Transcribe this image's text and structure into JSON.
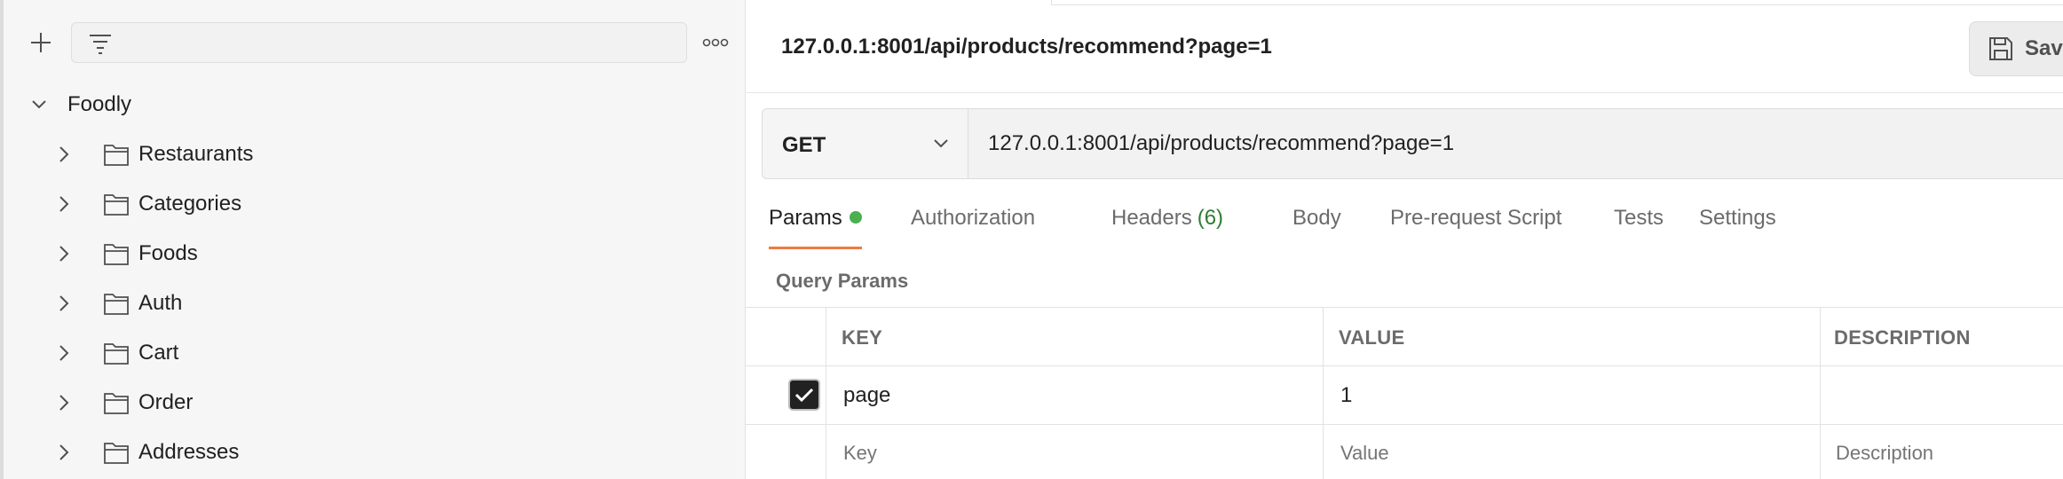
{
  "sidebar": {
    "filter_placeholder": "",
    "collection": {
      "name": "Foodly",
      "folders": [
        {
          "label": "Restaurants"
        },
        {
          "label": "Categories"
        },
        {
          "label": "Foods"
        },
        {
          "label": "Auth"
        },
        {
          "label": "Cart"
        },
        {
          "label": "Order"
        },
        {
          "label": "Addresses"
        }
      ]
    }
  },
  "header": {
    "title": "127.0.0.1:8001/api/products/recommend?page=1",
    "save_label": "Save"
  },
  "request": {
    "method": "GET",
    "url": "127.0.0.1:8001/api/products/recommend?page=1"
  },
  "tabs": {
    "params": "Params",
    "authorization": "Authorization",
    "headers": "Headers",
    "headers_count": "(6)",
    "body": "Body",
    "prerequest": "Pre-request Script",
    "tests": "Tests",
    "settings": "Settings"
  },
  "query_params": {
    "title": "Query Params",
    "columns": {
      "key": "KEY",
      "value": "VALUE",
      "description": "DESCRIPTION"
    },
    "rows": [
      {
        "key": "page",
        "value": "1",
        "description": "",
        "checked": true
      }
    ],
    "placeholders": {
      "key": "Key",
      "value": "Value",
      "description": "Description"
    }
  },
  "colors": {
    "accent": "#ef7a3f",
    "status_dot": "#4caf50",
    "headers_count": "#2e7d32"
  },
  "icons": {
    "plus": "plus-icon",
    "filter": "filter-icon",
    "more": "more-horizontal-icon",
    "chevron_right": "chevron-right-icon",
    "chevron_down": "chevron-down-icon",
    "folder": "folder-icon",
    "save": "save-icon",
    "check": "check-icon"
  }
}
